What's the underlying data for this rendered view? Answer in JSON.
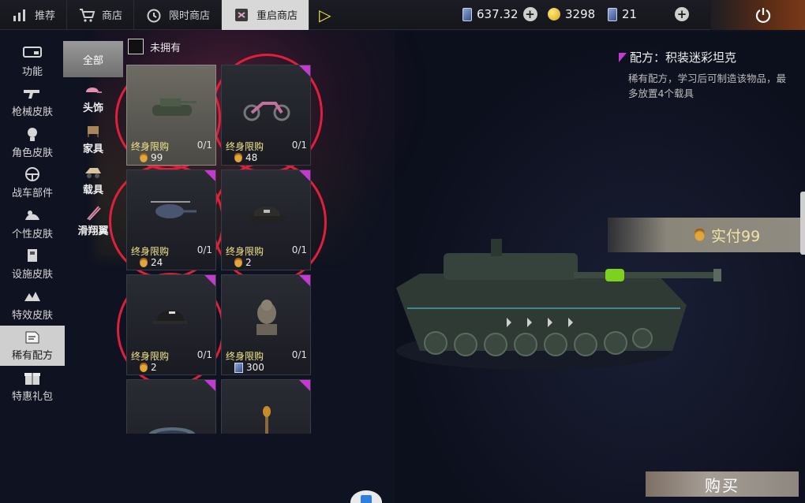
{
  "tabs": [
    {
      "label": "推荐",
      "icon": "chart-icon"
    },
    {
      "label": "商店",
      "icon": "cart-icon"
    },
    {
      "label": "限时商店",
      "icon": "clock-icon"
    },
    {
      "label": "重启商店",
      "icon": "restart-shop-icon"
    }
  ],
  "currency": {
    "tickets": "637.32",
    "coins": "3298",
    "cards": "21"
  },
  "sidebar": {
    "items": [
      {
        "label": "功能",
        "icon": "function-icon"
      },
      {
        "label": "枪械皮肤",
        "icon": "gun-icon"
      },
      {
        "label": "角色皮肤",
        "icon": "character-icon"
      },
      {
        "label": "战车部件",
        "icon": "steering-wheel-icon"
      },
      {
        "label": "个性皮肤",
        "icon": "personal-icon"
      },
      {
        "label": "设施皮肤",
        "icon": "facility-icon"
      },
      {
        "label": "特效皮肤",
        "icon": "effect-icon"
      },
      {
        "label": "稀有配方",
        "icon": "recipe-icon"
      },
      {
        "label": "特惠礼包",
        "icon": "gift-icon"
      }
    ],
    "active": "稀有配方"
  },
  "subcategory": {
    "all": "全部",
    "items": [
      {
        "label": "头饰",
        "icon": "cap-icon"
      },
      {
        "label": "家具",
        "icon": "furniture-icon"
      },
      {
        "label": "载具",
        "icon": "vehicle-icon"
      },
      {
        "label": "滑翔翼",
        "icon": "glider-icon"
      }
    ]
  },
  "filter": {
    "owned_label": "未拥有"
  },
  "items": [
    {
      "limit": "终身限购",
      "qty": "0/1",
      "price": "99",
      "currency": "medal",
      "thumb": "tank-icon"
    },
    {
      "limit": "终身限购",
      "qty": "0/1",
      "price": "48",
      "currency": "medal",
      "thumb": "motorcycle-icon"
    },
    {
      "limit": "终身限购",
      "qty": "0/1",
      "price": "24",
      "currency": "medal",
      "thumb": "helicopter-icon"
    },
    {
      "limit": "终身限购",
      "qty": "0/1",
      "price": "2",
      "currency": "medal",
      "thumb": "police-hat-icon"
    },
    {
      "limit": "终身限购",
      "qty": "0/1",
      "price": "2",
      "currency": "medal",
      "thumb": "baseball-cap-icon"
    },
    {
      "limit": "终身限购",
      "qty": "0/1",
      "price": "300",
      "currency": "ticket",
      "thumb": "lion-statue-icon"
    },
    {
      "limit": "",
      "qty": "",
      "price": "",
      "currency": "",
      "thumb": "pond-icon"
    },
    {
      "limit": "",
      "qty": "",
      "price": "",
      "currency": "",
      "thumb": "torch-icon"
    }
  ],
  "detail": {
    "title": "配方：积装迷彩坦克",
    "description": "稀有配方，学习后可制造该物品，最多放置4个载具",
    "pay_label": "实付99"
  },
  "buy_label": "购买",
  "colors": {
    "accent_magenta": "#c23ad0",
    "highlight_ring": "#e01f3a",
    "limit_text": "#f2e58a"
  }
}
